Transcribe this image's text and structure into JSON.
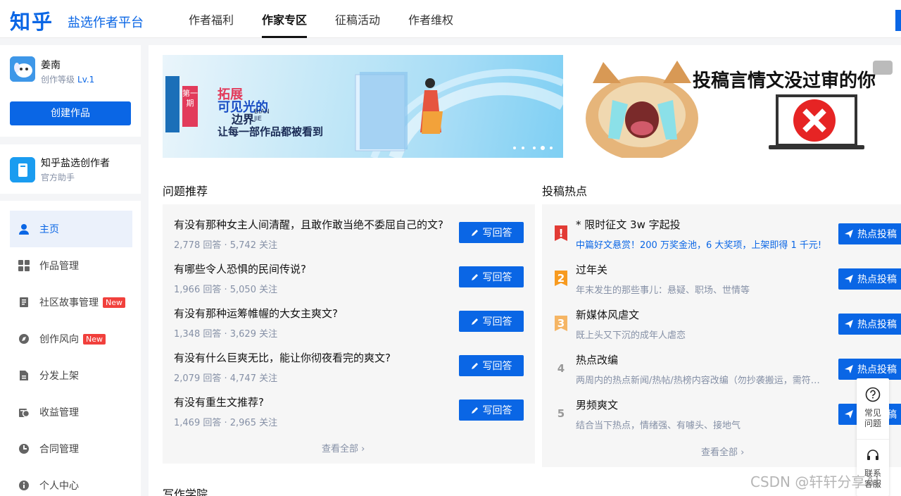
{
  "header": {
    "logo": "知乎",
    "subtitle": "盐选作者平台",
    "nav": [
      "作者福利",
      "作家专区",
      "征稿活动",
      "作者维权"
    ],
    "active_nav": "作家专区"
  },
  "user": {
    "name": "姜南",
    "level_label": "创作等级",
    "level": "Lv.1",
    "create_button": "创建作品"
  },
  "assistant": {
    "name": "知乎盐选创作者",
    "subtitle": "官方助手"
  },
  "sidebar": {
    "items": [
      {
        "label": "主页",
        "icon": "user-icon",
        "active": true,
        "badge": ""
      },
      {
        "label": "作品管理",
        "icon": "grid-icon",
        "active": false,
        "badge": ""
      },
      {
        "label": "社区故事管理",
        "icon": "document-icon",
        "active": false,
        "badge": "New"
      },
      {
        "label": "创作风向",
        "icon": "compass-icon",
        "active": false,
        "badge": "New"
      },
      {
        "label": "分发上架",
        "icon": "file-icon",
        "active": false,
        "badge": ""
      },
      {
        "label": "收益管理",
        "icon": "money-icon",
        "active": false,
        "badge": ""
      },
      {
        "label": "合同管理",
        "icon": "contract-icon",
        "active": false,
        "badge": ""
      },
      {
        "label": "个人中心",
        "icon": "info-icon",
        "active": false,
        "badge": ""
      }
    ]
  },
  "banners": {
    "first": {
      "issue": "第一期",
      "line1": "拓展",
      "line2": "可见光的",
      "line3": "边界",
      "pinyin": "BIAN JIE",
      "tagline": "让每一部作品都被看到"
    },
    "second": {
      "text": "投稿言情文没过审的你"
    }
  },
  "questions": {
    "title": "问题推荐",
    "answer_button": "写回答",
    "see_all": "查看全部",
    "items": [
      {
        "title": "有没有那种女主人间清醒，且敢作敢当绝不委屈自己的文?",
        "meta": "2,778 回答 · 5,742 关注"
      },
      {
        "title": "有哪些令人恐惧的民间传说?",
        "meta": "1,966 回答 · 5,050 关注"
      },
      {
        "title": "有没有那种运筹帷幄的大女主爽文?",
        "meta": "1,348 回答 · 3,629 关注"
      },
      {
        "title": "有没有什么巨爽无比，能让你彻夜看完的爽文?",
        "meta": "2,079 回答 · 4,747 关注"
      },
      {
        "title": "有没有重生文推荐?",
        "meta": "1,469 回答 · 2,965 关注"
      }
    ]
  },
  "hot": {
    "title": "投稿热点",
    "button": "热点投稿",
    "see_all": "查看全部",
    "items": [
      {
        "rank": "!",
        "title": "* 限时征文 3w 字起投",
        "desc": "中篇好文悬赏！200 万奖金池，6 大奖项，上架即得 1 千元!",
        "color": "#e23b35",
        "desc_color": "#0a66e5"
      },
      {
        "rank": "2",
        "title": "过年关",
        "desc": "年末发生的那些事儿：悬疑、职场、世情等",
        "color": "#f79a1f",
        "desc_color": "#8590a6"
      },
      {
        "rank": "3",
        "title": "新媒体风虐文",
        "desc": "既上头又下沉的成年人虐恋",
        "color": "#f5b564",
        "desc_color": "#8590a6"
      },
      {
        "rank": "4",
        "title": "热点改编",
        "desc": "两周内的热点新闻/热帖/热榜内容改编（勿抄袭搬运，需符合平台规范）",
        "color": "",
        "desc_color": "#8590a6"
      },
      {
        "rank": "5",
        "title": "男频爽文",
        "desc": "结合当下热点，情绪强、有噱头、接地气",
        "color": "",
        "desc_color": "#8590a6"
      }
    ]
  },
  "float": {
    "faq": "常见问题",
    "contact": "联系客服"
  },
  "bottom": {
    "title": "写作学院"
  },
  "watermark": "CSDN @轩轩分享AI"
}
